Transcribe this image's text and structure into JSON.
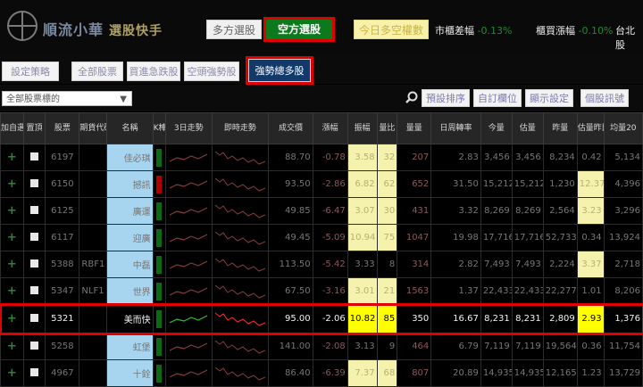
{
  "app": {
    "title": "順流小華",
    "subtitle": "選股快手"
  },
  "header": {
    "multi_label": "多方選股",
    "short_label": "空方選股",
    "today_label": "今日多空權數",
    "market_diff_label": "市櫃差幅",
    "market_diff_value": "-0.13%",
    "buy_rate_label": "櫃買漲幅",
    "buy_rate_value": "-0.10%",
    "taiex_label": "台北股"
  },
  "tabs": [
    "設定策略",
    "全部股票",
    "買進急跌股",
    "空頭強勢股",
    "強勢總多股"
  ],
  "active_tab": "強勢總多股",
  "search": {
    "select_value": "全部股票標的",
    "caret": "▼"
  },
  "toolbar": [
    "預設排序",
    "自訂欄位",
    "顯示設定",
    "個股訊號"
  ],
  "columns": [
    "加自選",
    "置頂",
    "股票",
    "期貨代碼",
    "名稱",
    "K棒",
    "3日走勢",
    "即時走勢",
    "成交價",
    "漲幅",
    "振幅",
    "量比",
    "量量",
    "日周轉率",
    "今量",
    "估量",
    "昨量",
    "估量昨比",
    "均量20"
  ],
  "rows": [
    {
      "code": "6197",
      "fut": "",
      "name": "佳必琪",
      "price": "88.70",
      "chg": "-0.78",
      "amp": "3.58",
      "vr": "32",
      "vol": "207",
      "turn": "2.83",
      "tv": "3,456",
      "ev": "3,456",
      "yv": "8,234",
      "ratio": "0.42",
      "avg": "5,134",
      "k": "green",
      "hl": false
    },
    {
      "code": "6150",
      "fut": "",
      "name": "撼訊",
      "price": "93.50",
      "chg": "-2.86",
      "amp": "6.82",
      "vr": "62",
      "vol": "652",
      "turn": "31.50",
      "tv": "15,212",
      "ev": "15,212",
      "yv": "1,230",
      "ratio": "12.37",
      "avg": "4,396",
      "k": "red",
      "hl": false
    },
    {
      "code": "6125",
      "fut": "",
      "name": "廣運",
      "price": "49.85",
      "chg": "-6.47",
      "amp": "3.07",
      "vr": "30",
      "vol": "431",
      "turn": "3.32",
      "tv": "8,269",
      "ev": "8,269",
      "yv": "2,564",
      "ratio": "3.23",
      "avg": "3,296",
      "k": "green",
      "hl": false
    },
    {
      "code": "6117",
      "fut": "",
      "name": "迎廣",
      "price": "49.45",
      "chg": "-5.09",
      "amp": "10.94",
      "vr": "75",
      "vol": "1047",
      "turn": "19.98",
      "tv": "17,716",
      "ev": "17,716",
      "yv": "52,733",
      "ratio": "0.34",
      "avg": "13,924",
      "k": "green",
      "hl": false
    },
    {
      "code": "5388",
      "fut": "RBF1",
      "name": "中磊",
      "price": "113.50",
      "chg": "-5.42",
      "amp": "3.33",
      "vr": "8",
      "vol": "314",
      "turn": "2.82",
      "tv": "7,493",
      "ev": "7,493",
      "yv": "2,224",
      "ratio": "3.37",
      "avg": "2,718",
      "k": "green",
      "hl": false
    },
    {
      "code": "5347",
      "fut": "NLF1",
      "name": "世界",
      "price": "67.50",
      "chg": "-3.16",
      "amp": "3.01",
      "vr": "21",
      "vol": "1563",
      "turn": "1.37",
      "tv": "22,433",
      "ev": "22,433",
      "yv": "22,277",
      "ratio": "1.01",
      "avg": "8,206",
      "k": "green",
      "hl": false
    },
    {
      "code": "5321",
      "fut": "",
      "name": "美而快",
      "price": "95.00",
      "chg": "-2.06",
      "amp": "10.82",
      "vr": "85",
      "vol": "350",
      "turn": "16.67",
      "tv": "8,231",
      "ev": "8,231",
      "yv": "2,809",
      "ratio": "2.93",
      "avg": "1,376",
      "k": "green",
      "hl": true
    },
    {
      "code": "5258",
      "fut": "",
      "name": "虹堡",
      "price": "141.00",
      "chg": "-2.08",
      "amp": "3.13",
      "vr": "9",
      "vol": "464",
      "turn": "6.79",
      "tv": "7,119",
      "ev": "7,119",
      "yv": "19,564",
      "ratio": "0.36",
      "avg": "11,754",
      "k": "green",
      "hl": false
    },
    {
      "code": "4967",
      "fut": "",
      "name": "十銓",
      "price": "86.40",
      "chg": "-6.39",
      "amp": "7.37",
      "vr": "68",
      "vol": "807",
      "turn": "20.89",
      "tv": "14,935",
      "ev": "14,935",
      "yv": "12,165",
      "ratio": "1.23",
      "avg": "13,729",
      "k": "green",
      "hl": false
    }
  ],
  "colors": {
    "accent_red": "#e00000",
    "short_green": "#0c7a1c",
    "tab_blue": "#113a6b",
    "highlight_yellow": "#ffff00",
    "name_blue": "#a7d4ee"
  }
}
